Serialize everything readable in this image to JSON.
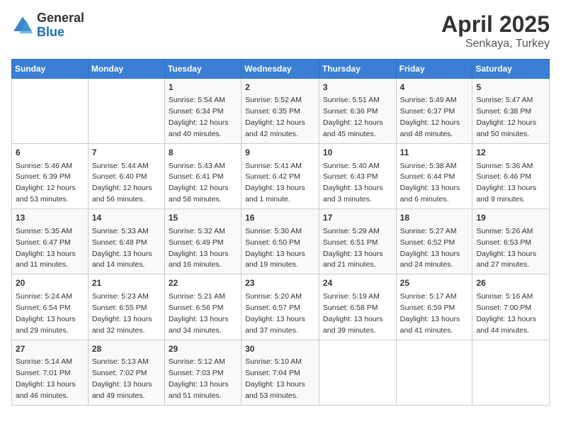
{
  "header": {
    "logo_general": "General",
    "logo_blue": "Blue",
    "title": "April 2025",
    "location": "Senkaya, Turkey"
  },
  "columns": [
    "Sunday",
    "Monday",
    "Tuesday",
    "Wednesday",
    "Thursday",
    "Friday",
    "Saturday"
  ],
  "weeks": [
    [
      {
        "day": "",
        "info": ""
      },
      {
        "day": "",
        "info": ""
      },
      {
        "day": "1",
        "info": "Sunrise: 5:54 AM\nSunset: 6:34 PM\nDaylight: 12 hours and 40 minutes."
      },
      {
        "day": "2",
        "info": "Sunrise: 5:52 AM\nSunset: 6:35 PM\nDaylight: 12 hours and 42 minutes."
      },
      {
        "day": "3",
        "info": "Sunrise: 5:51 AM\nSunset: 6:36 PM\nDaylight: 12 hours and 45 minutes."
      },
      {
        "day": "4",
        "info": "Sunrise: 5:49 AM\nSunset: 6:37 PM\nDaylight: 12 hours and 48 minutes."
      },
      {
        "day": "5",
        "info": "Sunrise: 5:47 AM\nSunset: 6:38 PM\nDaylight: 12 hours and 50 minutes."
      }
    ],
    [
      {
        "day": "6",
        "info": "Sunrise: 5:46 AM\nSunset: 6:39 PM\nDaylight: 12 hours and 53 minutes."
      },
      {
        "day": "7",
        "info": "Sunrise: 5:44 AM\nSunset: 6:40 PM\nDaylight: 12 hours and 56 minutes."
      },
      {
        "day": "8",
        "info": "Sunrise: 5:43 AM\nSunset: 6:41 PM\nDaylight: 12 hours and 58 minutes."
      },
      {
        "day": "9",
        "info": "Sunrise: 5:41 AM\nSunset: 6:42 PM\nDaylight: 13 hours and 1 minute."
      },
      {
        "day": "10",
        "info": "Sunrise: 5:40 AM\nSunset: 6:43 PM\nDaylight: 13 hours and 3 minutes."
      },
      {
        "day": "11",
        "info": "Sunrise: 5:38 AM\nSunset: 6:44 PM\nDaylight: 13 hours and 6 minutes."
      },
      {
        "day": "12",
        "info": "Sunrise: 5:36 AM\nSunset: 6:46 PM\nDaylight: 13 hours and 9 minutes."
      }
    ],
    [
      {
        "day": "13",
        "info": "Sunrise: 5:35 AM\nSunset: 6:47 PM\nDaylight: 13 hours and 11 minutes."
      },
      {
        "day": "14",
        "info": "Sunrise: 5:33 AM\nSunset: 6:48 PM\nDaylight: 13 hours and 14 minutes."
      },
      {
        "day": "15",
        "info": "Sunrise: 5:32 AM\nSunset: 6:49 PM\nDaylight: 13 hours and 16 minutes."
      },
      {
        "day": "16",
        "info": "Sunrise: 5:30 AM\nSunset: 6:50 PM\nDaylight: 13 hours and 19 minutes."
      },
      {
        "day": "17",
        "info": "Sunrise: 5:29 AM\nSunset: 6:51 PM\nDaylight: 13 hours and 21 minutes."
      },
      {
        "day": "18",
        "info": "Sunrise: 5:27 AM\nSunset: 6:52 PM\nDaylight: 13 hours and 24 minutes."
      },
      {
        "day": "19",
        "info": "Sunrise: 5:26 AM\nSunset: 6:53 PM\nDaylight: 13 hours and 27 minutes."
      }
    ],
    [
      {
        "day": "20",
        "info": "Sunrise: 5:24 AM\nSunset: 6:54 PM\nDaylight: 13 hours and 29 minutes."
      },
      {
        "day": "21",
        "info": "Sunrise: 5:23 AM\nSunset: 6:55 PM\nDaylight: 13 hours and 32 minutes."
      },
      {
        "day": "22",
        "info": "Sunrise: 5:21 AM\nSunset: 6:56 PM\nDaylight: 13 hours and 34 minutes."
      },
      {
        "day": "23",
        "info": "Sunrise: 5:20 AM\nSunset: 6:57 PM\nDaylight: 13 hours and 37 minutes."
      },
      {
        "day": "24",
        "info": "Sunrise: 5:19 AM\nSunset: 6:58 PM\nDaylight: 13 hours and 39 minutes."
      },
      {
        "day": "25",
        "info": "Sunrise: 5:17 AM\nSunset: 6:59 PM\nDaylight: 13 hours and 41 minutes."
      },
      {
        "day": "26",
        "info": "Sunrise: 5:16 AM\nSunset: 7:00 PM\nDaylight: 13 hours and 44 minutes."
      }
    ],
    [
      {
        "day": "27",
        "info": "Sunrise: 5:14 AM\nSunset: 7:01 PM\nDaylight: 13 hours and 46 minutes."
      },
      {
        "day": "28",
        "info": "Sunrise: 5:13 AM\nSunset: 7:02 PM\nDaylight: 13 hours and 49 minutes."
      },
      {
        "day": "29",
        "info": "Sunrise: 5:12 AM\nSunset: 7:03 PM\nDaylight: 13 hours and 51 minutes."
      },
      {
        "day": "30",
        "info": "Sunrise: 5:10 AM\nSunset: 7:04 PM\nDaylight: 13 hours and 53 minutes."
      },
      {
        "day": "",
        "info": ""
      },
      {
        "day": "",
        "info": ""
      },
      {
        "day": "",
        "info": ""
      }
    ]
  ]
}
